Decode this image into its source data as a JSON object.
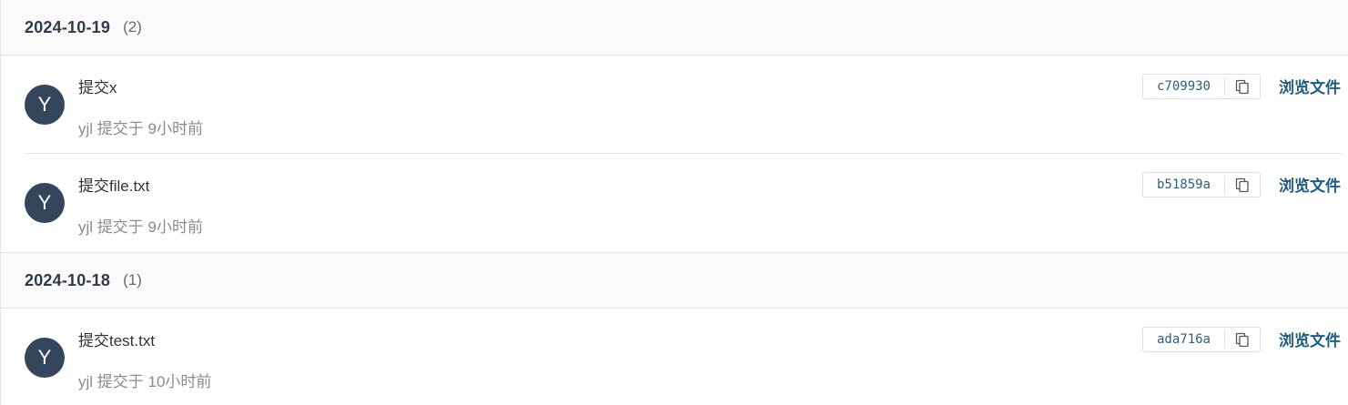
{
  "groups": [
    {
      "date": "2024-10-19",
      "count": "(2)",
      "commits": [
        {
          "avatar_letter": "Y",
          "title": "提交x",
          "meta": "yjl 提交于 9小时前",
          "sha": "c709930",
          "browse_label": "浏览文件"
        },
        {
          "avatar_letter": "Y",
          "title": "提交file.txt",
          "meta": "yjl 提交于 9小时前",
          "sha": "b51859a",
          "browse_label": "浏览文件"
        }
      ]
    },
    {
      "date": "2024-10-18",
      "count": "(1)",
      "commits": [
        {
          "avatar_letter": "Y",
          "title": "提交test.txt",
          "meta": "yjl 提交于 10小时前",
          "sha": "ada716a",
          "browse_label": "浏览文件"
        }
      ]
    }
  ],
  "colors": {
    "avatar_bg": "#34465c",
    "link": "#1f5c82",
    "sha": "#2e5f7a",
    "header_bg": "#fafafa"
  },
  "icons": {
    "copy": "copy-icon"
  }
}
